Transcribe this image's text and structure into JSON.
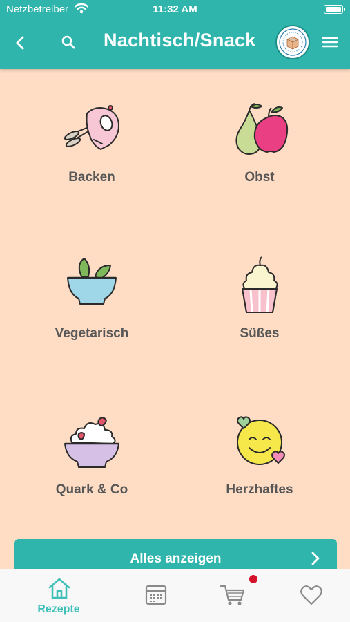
{
  "status_bar": {
    "carrier": "Netzbetreiber",
    "time": "11:32 AM"
  },
  "nav": {
    "title": "Nachtisch/Snack",
    "back_icon": "chevron-left-icon",
    "search_icon": "search-icon",
    "menu_icon": "hamburger-menu-icon",
    "logo": "brand-logo-badge"
  },
  "categories": [
    {
      "label": "Backen",
      "icon": "hand-mixer-icon"
    },
    {
      "label": "Obst",
      "icon": "pear-apple-icon"
    },
    {
      "label": "Vegetarisch",
      "icon": "salad-bowl-icon"
    },
    {
      "label": "Süßes",
      "icon": "cupcake-icon"
    },
    {
      "label": "Quark & Co",
      "icon": "quark-bowl-icon"
    },
    {
      "label": "Herzhaftes",
      "icon": "smiley-hearts-icon"
    }
  ],
  "show_all": {
    "label": "Alles anzeigen"
  },
  "tabs": [
    {
      "label": "Rezepte",
      "icon": "home-icon",
      "active": true
    },
    {
      "label": "",
      "icon": "calendar-icon",
      "active": false
    },
    {
      "label": "",
      "icon": "cart-icon",
      "active": false,
      "badge": true
    },
    {
      "label": "",
      "icon": "heart-icon",
      "active": false
    }
  ],
  "colors": {
    "primary": "#30b5ad",
    "background": "#ffdcc4",
    "label": "#575757",
    "active_tab": "#3ec0b8",
    "badge": "#d4122a",
    "inactive_tab": "#8a8a8a"
  }
}
